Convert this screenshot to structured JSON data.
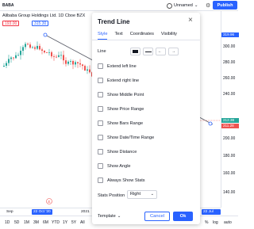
{
  "toolbar": {
    "symbol": "BABA",
    "layout_name": "Unnamed",
    "publish_label": "Publish"
  },
  "chart": {
    "title": "Alibaba Group Holdings Ltd.  1D  Cboe BZX",
    "price_a": "193.00",
    "price_b": "315.30",
    "price_ticks": [
      "300.00",
      "280.00",
      "260.00",
      "240.00",
      "220.00",
      "200.00",
      "180.00",
      "160.00",
      "140.00"
    ],
    "tag_blue": "319.96",
    "tag_green": "212.38",
    "tag_red": "211.28",
    "time_labels": {
      "sep": "Sep",
      "highlight_left": "22 Oct '20",
      "year": "2021",
      "highlight_right": "22 Jul '21"
    },
    "marker": "E"
  },
  "ranges": [
    "1D",
    "5D",
    "1M",
    "3M",
    "6M",
    "YTD",
    "1Y",
    "5Y",
    "All"
  ],
  "bottom_right": {
    "percent": "%",
    "log": "log",
    "auto": "auto"
  },
  "dialog": {
    "title": "Trend Line",
    "tabs": [
      "Style",
      "Text",
      "Coordinates",
      "Visibility"
    ],
    "line_label": "Line",
    "checkboxes": [
      "Extend left line",
      "Extend right line",
      "Show Middle Point",
      "Show Price Range",
      "Show Bars Range",
      "Show Date/Time Range",
      "Show Distance",
      "Show Angle",
      "Always Show Stats"
    ],
    "stats_position_label": "Stats Position",
    "stats_position_value": "Right",
    "template_label": "Template",
    "cancel_label": "Cancel",
    "ok_label": "Ok"
  },
  "colors": {
    "accent": "#2962ff",
    "up": "#26a69a",
    "down": "#ef5350"
  }
}
